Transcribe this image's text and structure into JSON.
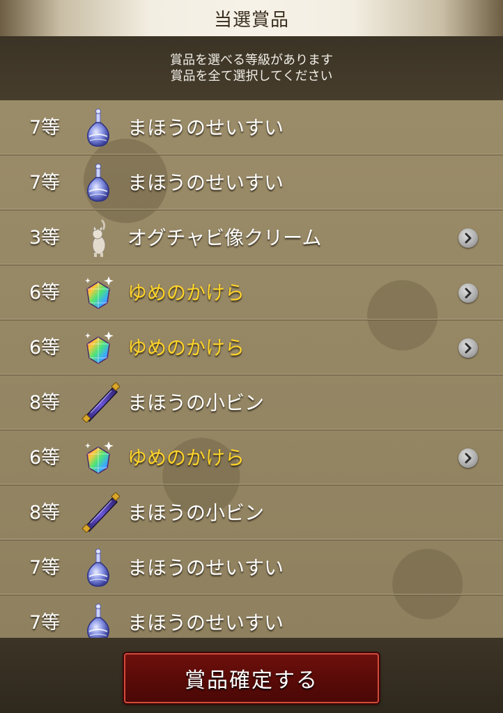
{
  "header": {
    "title": "当選賞品"
  },
  "notice": {
    "line1": "賞品を選べる等級があります",
    "line2": "賞品を全て選択してください"
  },
  "prizes": [
    {
      "grade": "7等",
      "name": "まほうのせいすい",
      "icon": "potion-icon",
      "highlight": false,
      "selectable": false
    },
    {
      "grade": "7等",
      "name": "まほうのせいすい",
      "icon": "potion-icon",
      "highlight": false,
      "selectable": false
    },
    {
      "grade": "3等",
      "name": "オグチャビ像クリーム",
      "icon": "cat-statue-icon",
      "highlight": false,
      "selectable": true
    },
    {
      "grade": "6等",
      "name": "ゆめのかけら",
      "icon": "rainbow-gem-icon",
      "highlight": true,
      "selectable": true
    },
    {
      "grade": "6等",
      "name": "ゆめのかけら",
      "icon": "rainbow-gem-icon",
      "highlight": true,
      "selectable": true
    },
    {
      "grade": "8等",
      "name": "まほうの小ビン",
      "icon": "wand-bottle-icon",
      "highlight": false,
      "selectable": false
    },
    {
      "grade": "6等",
      "name": "ゆめのかけら",
      "icon": "rainbow-gem-icon",
      "highlight": true,
      "selectable": true
    },
    {
      "grade": "8等",
      "name": "まほうの小ビン",
      "icon": "wand-bottle-icon",
      "highlight": false,
      "selectable": false
    },
    {
      "grade": "7等",
      "name": "まほうのせいすい",
      "icon": "potion-icon",
      "highlight": false,
      "selectable": false
    },
    {
      "grade": "7等",
      "name": "まほうのせいすい",
      "icon": "potion-icon",
      "highlight": false,
      "selectable": false
    }
  ],
  "footer": {
    "confirm_label": "賞品確定する"
  },
  "colors": {
    "highlight_text": "#ffd42a",
    "button_bg": "#5a0b08",
    "button_border": "#d24b3c"
  }
}
